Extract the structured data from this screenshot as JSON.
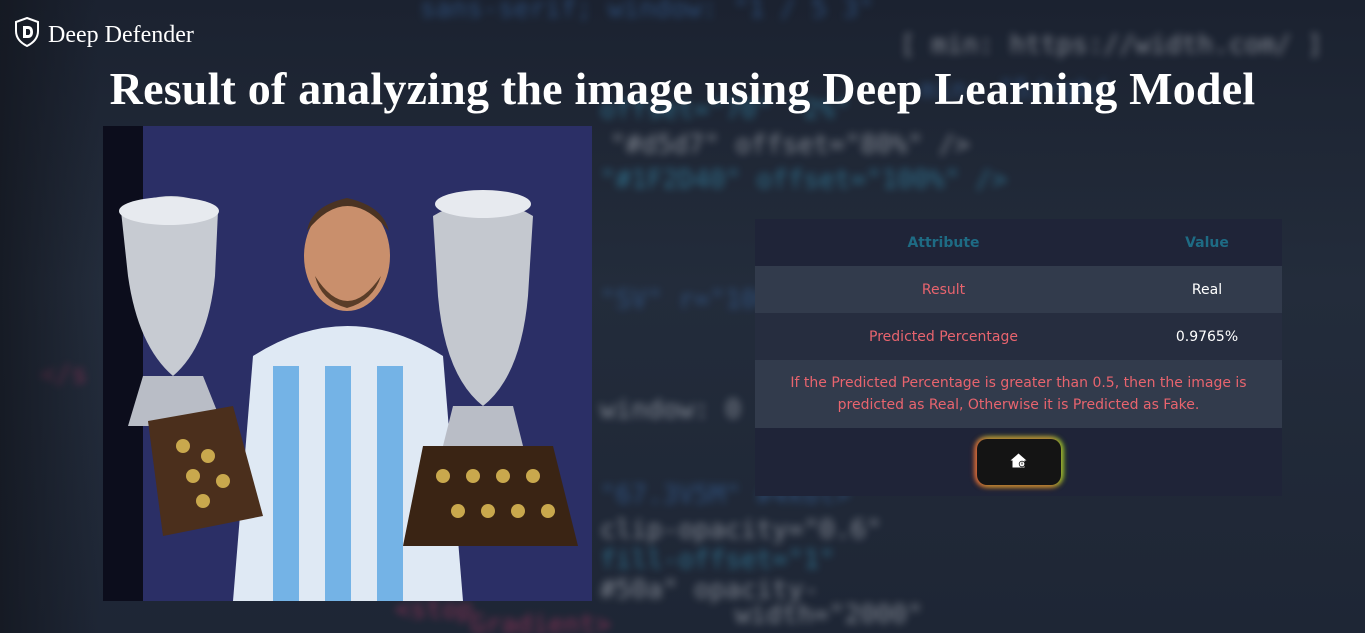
{
  "brand": {
    "name": "Deep Defender",
    "icon": "shield-logo-icon"
  },
  "page": {
    "title": "Result of analyzing the image using Deep Learning Model"
  },
  "image": {
    "alt": "Analyzed image",
    "icon": "uploaded-photo"
  },
  "table": {
    "headers": {
      "attribute": "Attribute",
      "value": "Value"
    },
    "rows": [
      {
        "attribute": "Result",
        "value": "Real"
      },
      {
        "attribute": "Predicted Percentage",
        "value": "0.9765%"
      }
    ],
    "note": "If the Predicted Percentage is greater than 0.5, then the image is predicted as Real, Otherwise it is Predicted as Fake."
  },
  "home_button": {
    "icon": "home-icon"
  },
  "colors": {
    "header_text": "#1e6b84",
    "attribute_text": "#e8646e",
    "value_text": "#ffffff",
    "row_light": "#323b4c",
    "row_dark": "#262d3f"
  }
}
